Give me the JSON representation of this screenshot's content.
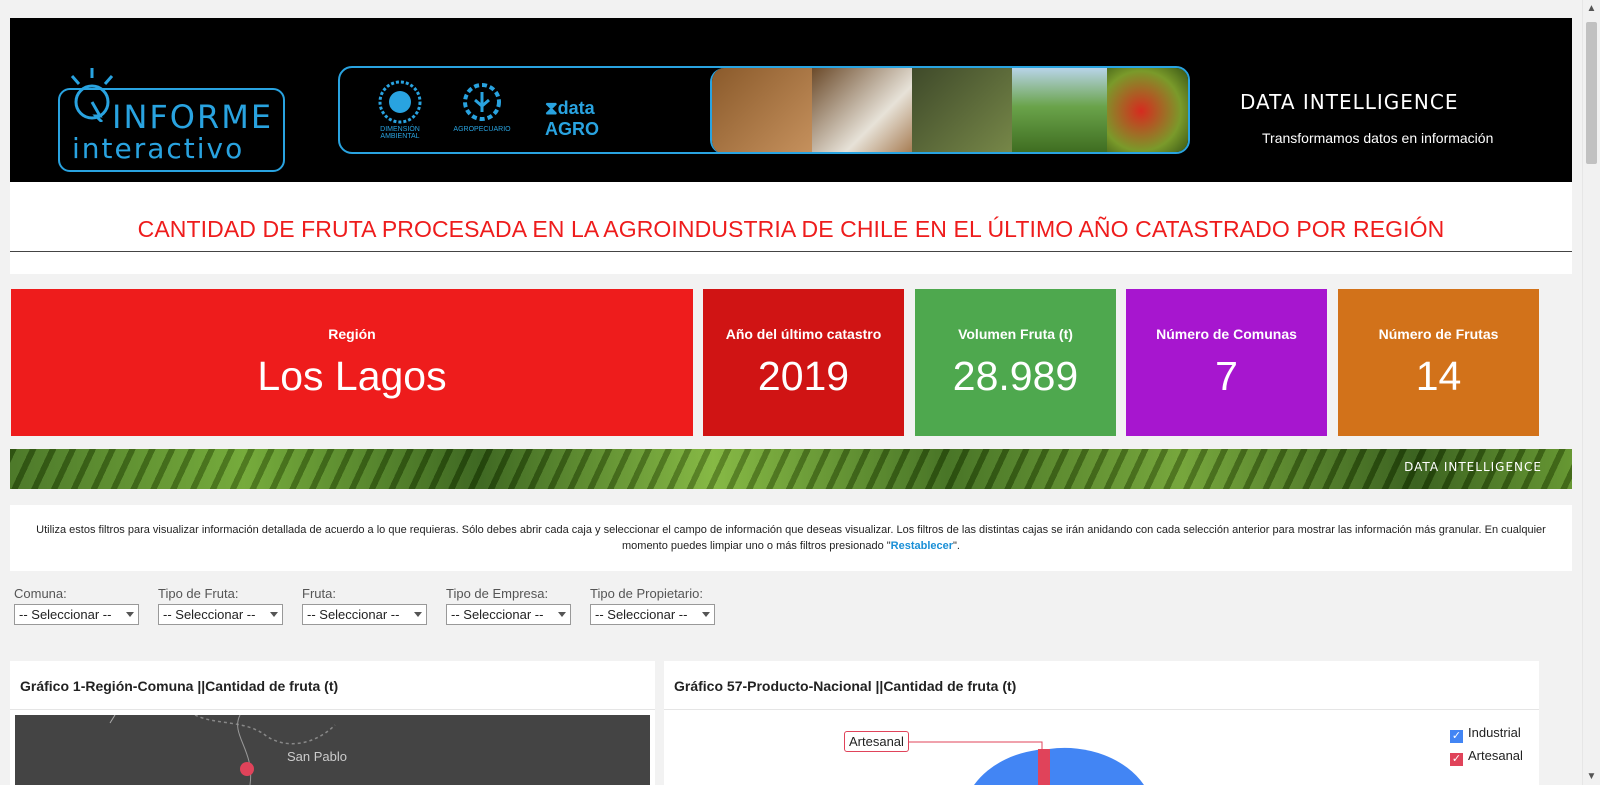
{
  "banner": {
    "logo_line1": "INFORME",
    "logo_line2": "interactivo",
    "partners": [
      {
        "name": "DIMENSIÓN AMBIENTAL",
        "icon": "sun-seal-icon"
      },
      {
        "name": "AGROPECUARIO",
        "icon": "gear-plant-icon"
      },
      {
        "name": "data AGRO",
        "icon": "hourglass-icon"
      }
    ],
    "di_brand": "DATA INTELLIGENCE",
    "di_tagline": "Transformamos datos en información"
  },
  "title": "CANTIDAD DE FRUTA PROCESADA EN LA AGROINDUSTRIA DE CHILE EN EL ÚLTIMO AÑO CATASTRADO POR REGIÓN",
  "kpis": [
    {
      "label": "Región",
      "value": "Los Lagos",
      "color": "#ee1c1c"
    },
    {
      "label": "Año del último catastro",
      "value": "2019",
      "color": "#d01414"
    },
    {
      "label": "Volumen Fruta (t)",
      "value": "28.989",
      "color": "#4ea84e"
    },
    {
      "label": "Número de Comunas",
      "value": "7",
      "color": "#a716cf"
    },
    {
      "label": "Número de Frutas",
      "value": "14",
      "color": "#d2721a"
    }
  ],
  "strip_brand": "DATA INTELLIGENCE",
  "instructions": {
    "text": "Utiliza estos filtros para visualizar información detallada de acuerdo a lo que requieras. Sólo debes abrir cada caja y seleccionar el campo de información que deseas visualizar. Los filtros de las distintas cajas se irán anidando con cada selección anterior para mostrar las información más granular. En cualquier momento puedes limpiar uno o más filtros presionado \"",
    "link": "Restablecer",
    "tail": "\"."
  },
  "filters": [
    {
      "label": "Comuna:",
      "value": "-- Seleccionar --"
    },
    {
      "label": "Tipo de Fruta:",
      "value": "-- Seleccionar --"
    },
    {
      "label": "Fruta:",
      "value": "-- Seleccionar --"
    },
    {
      "label": "Tipo de Empresa:",
      "value": "-- Seleccionar --"
    },
    {
      "label": "Tipo de Propietario:",
      "value": "-- Seleccionar --"
    }
  ],
  "cards": {
    "map_title": "Gráfico 1-Región-Comuna ||Cantidad de fruta (t)",
    "map_place": "San Pablo",
    "pie_title": "Gráfico 57-Producto-Nacional ||Cantidad de fruta (t)",
    "pie_callout": "Artesanal",
    "legend": [
      {
        "label": "Industrial",
        "color": "#4285f4"
      },
      {
        "label": "Artesanal",
        "color": "#e0435a"
      }
    ]
  }
}
